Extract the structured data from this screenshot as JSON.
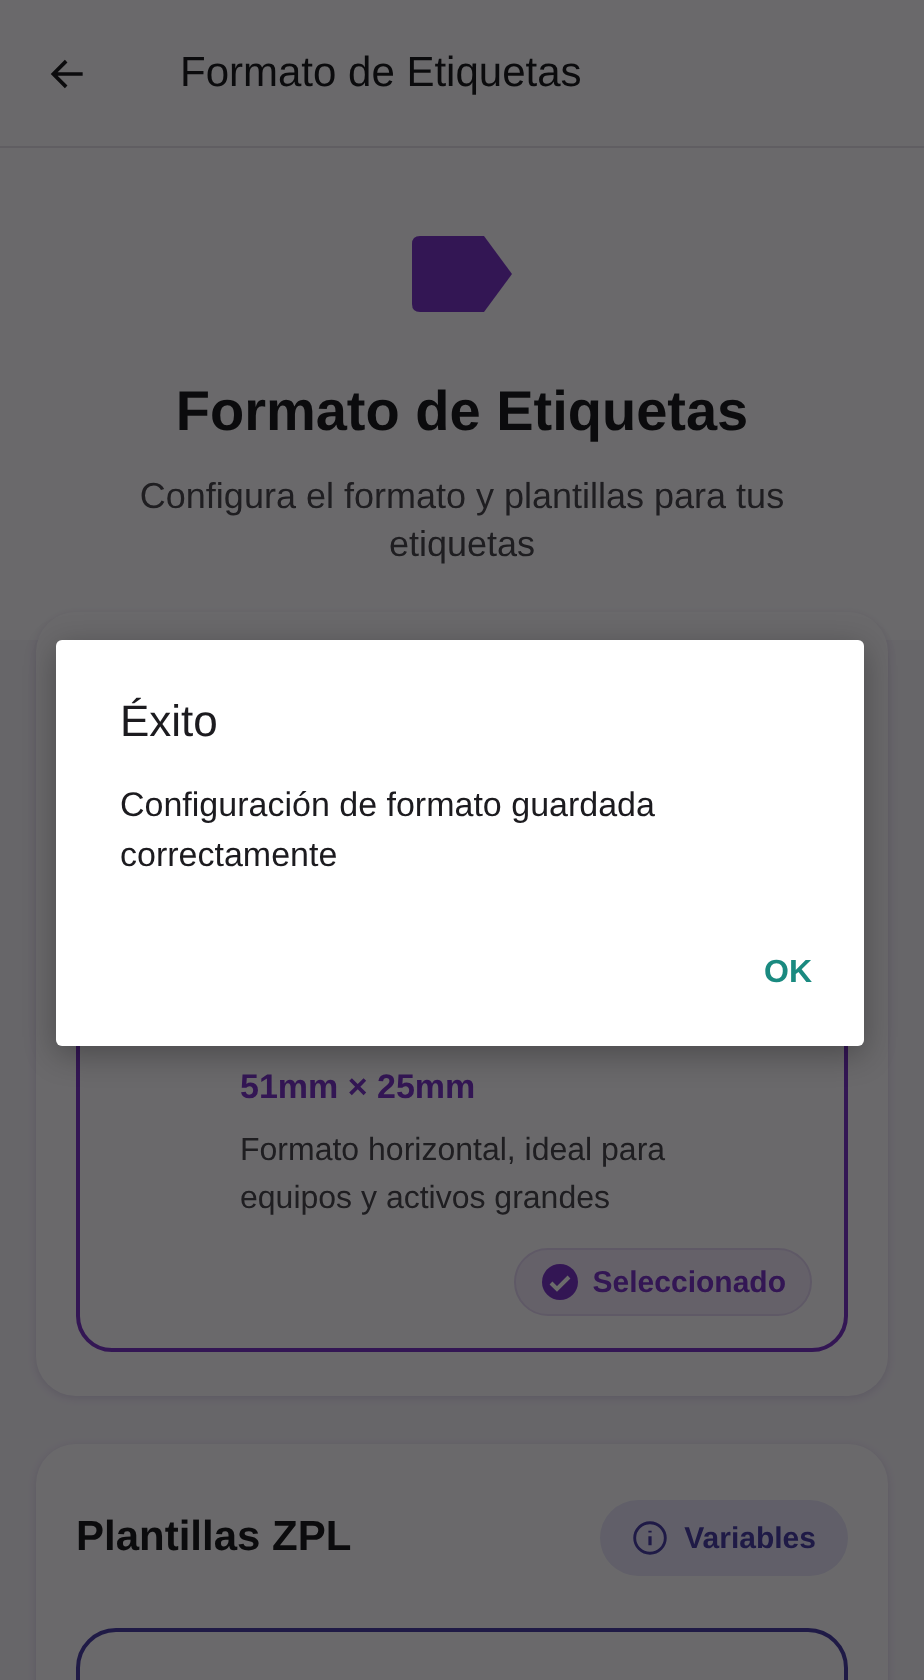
{
  "app_bar": {
    "title": "Formato de Etiquetas"
  },
  "header": {
    "title": "Formato de Etiquetas",
    "subtitle": "Configura el formato y plantillas para tus etiquetas"
  },
  "format_card": {
    "option": {
      "size": "51mm × 25mm",
      "description": "Formato horizontal, ideal para equipos y activos grandes",
      "badge": "Seleccionado",
      "selected": true
    }
  },
  "templates_card": {
    "title": "Plantillas ZPL",
    "button": "Variables"
  },
  "dialog": {
    "title": "Éxito",
    "message": "Configuración de formato guardada correctamente",
    "button": "OK"
  }
}
